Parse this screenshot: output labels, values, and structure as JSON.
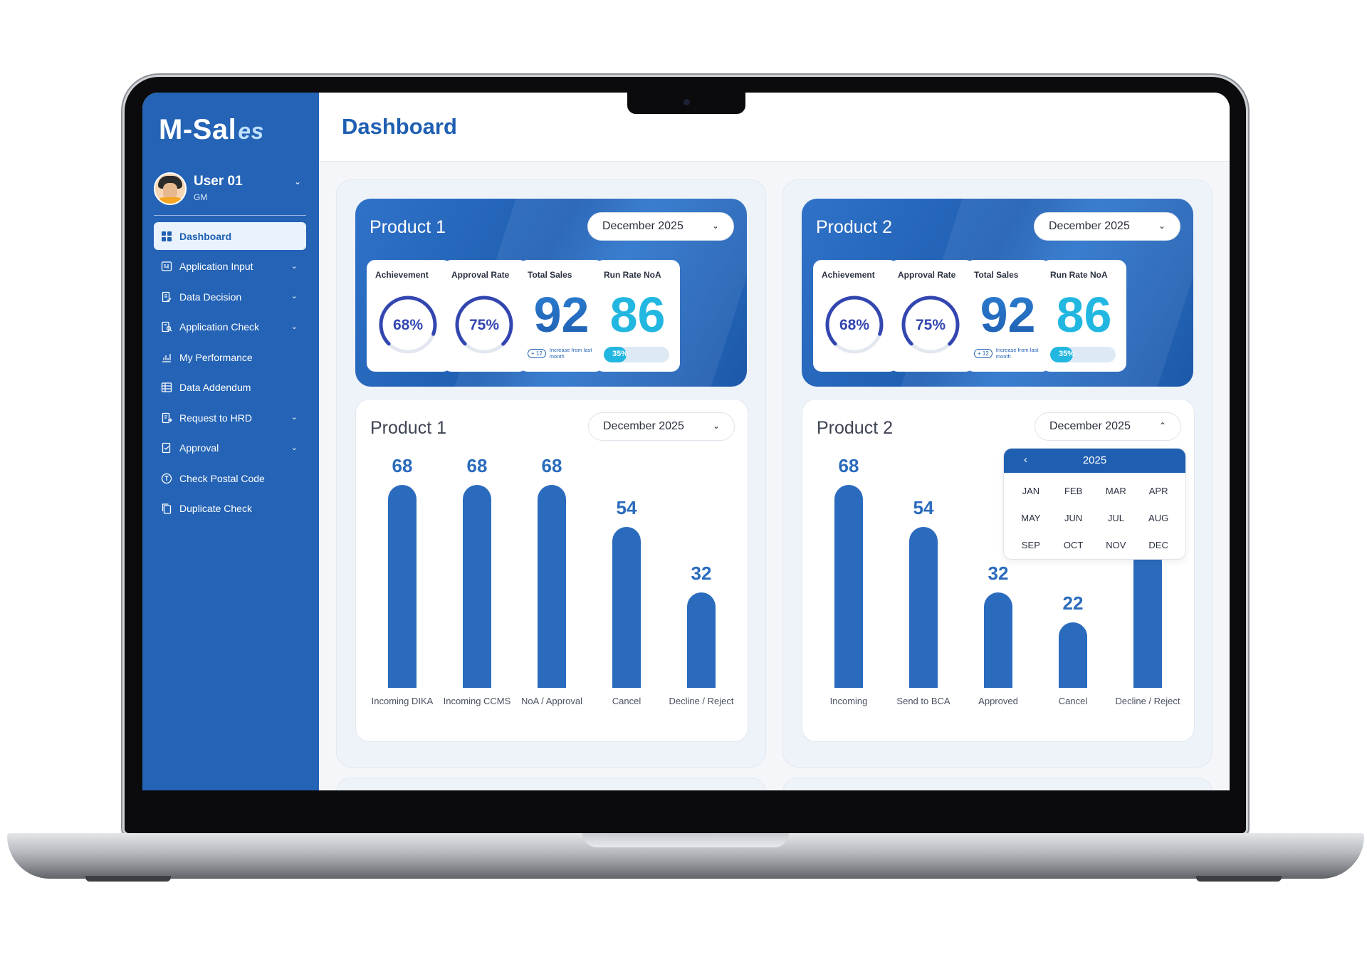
{
  "app": {
    "logo_text": "M-Sal",
    "logo_accent": "es",
    "brand_color": "#2463b5",
    "accent_color": "#22b7e0"
  },
  "user": {
    "name": "User 01",
    "role": "GM"
  },
  "sidebar": {
    "items": [
      {
        "label": "Dashboard",
        "icon": "grid-icon",
        "active": true,
        "has_submenu": false
      },
      {
        "label": "Application Input",
        "icon": "form-input-icon",
        "active": false,
        "has_submenu": true
      },
      {
        "label": "Data Decision",
        "icon": "document-check-icon",
        "active": false,
        "has_submenu": true
      },
      {
        "label": "Application Check",
        "icon": "document-search-icon",
        "active": false,
        "has_submenu": true
      },
      {
        "label": "My Performance",
        "icon": "performance-icon",
        "active": false,
        "has_submenu": false
      },
      {
        "label": "Data Addendum",
        "icon": "table-icon",
        "active": false,
        "has_submenu": false
      },
      {
        "label": "Request to HRD",
        "icon": "request-icon",
        "active": false,
        "has_submenu": true
      },
      {
        "label": "Approval",
        "icon": "approval-icon",
        "active": false,
        "has_submenu": true
      },
      {
        "label": "Check Postal Code",
        "icon": "postal-icon",
        "active": false,
        "has_submenu": false
      },
      {
        "label": "Duplicate Check",
        "icon": "copy-icon",
        "active": false,
        "has_submenu": false
      }
    ]
  },
  "header": {
    "title": "Dashboard"
  },
  "panels": [
    {
      "stats": {
        "title": "Product 1",
        "month": "December 2025",
        "achievement": {
          "label": "Achievement",
          "value": "68%",
          "fraction": 0.68
        },
        "approval_rate": {
          "label": "Approval Rate",
          "value": "75%",
          "fraction": 0.75
        },
        "total_sales": {
          "label": "Total Sales",
          "value": "92",
          "increase_badge": "+ 12",
          "increase_text": "Increase from last month"
        },
        "run_rate": {
          "label": "Run Rate NoA",
          "value": "86",
          "progress_label": "35%",
          "progress_fraction": 0.35
        }
      },
      "chart": {
        "title": "Product 1",
        "month": "December 2025",
        "dropdown_open": false
      }
    },
    {
      "stats": {
        "title": "Product 2",
        "month": "December 2025",
        "achievement": {
          "label": "Achievement",
          "value": "68%",
          "fraction": 0.68
        },
        "approval_rate": {
          "label": "Approval Rate",
          "value": "75%",
          "fraction": 0.75
        },
        "total_sales": {
          "label": "Total Sales",
          "value": "92",
          "increase_badge": "+ 12",
          "increase_text": "Increase from last month"
        },
        "run_rate": {
          "label": "Run Rate NoA",
          "value": "86",
          "progress_label": "35%",
          "progress_fraction": 0.35
        }
      },
      "chart": {
        "title": "Product 2",
        "month": "December 2025",
        "dropdown_open": true,
        "picker": {
          "year": "2025",
          "months": [
            "JAN",
            "FEB",
            "MAR",
            "APR",
            "MAY",
            "JUN",
            "JUL",
            "AUG",
            "SEP",
            "OCT",
            "NOV",
            "DEC"
          ]
        }
      }
    }
  ],
  "chart_data": [
    {
      "type": "bar",
      "title": "Product 1",
      "categories": [
        "Incoming DIKA",
        "Incoming CCMS",
        "NoA / Approval",
        "Cancel",
        "Decline / Reject"
      ],
      "values": [
        68,
        68,
        68,
        54,
        32
      ],
      "ylim": [
        0,
        68
      ],
      "bar_color": "#2a6bbd",
      "grid": false
    },
    {
      "type": "bar",
      "title": "Product 2",
      "categories": [
        "Incoming",
        "Send to BCA",
        "Approved",
        "Cancel",
        "Decline / Reject"
      ],
      "values": [
        68,
        54,
        32,
        22,
        47
      ],
      "ylim": [
        0,
        68
      ],
      "bar_color": "#2a6bbd",
      "grid": false
    }
  ]
}
